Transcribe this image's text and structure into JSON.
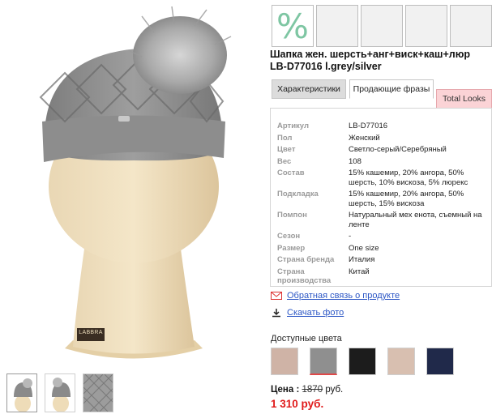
{
  "product": {
    "title_line1": "Шапка жен. шерсть+анг+виск+каш+люр",
    "title_line2": "LB-D77016 l.grey/silver",
    "sale_badge": "%",
    "brand_label": "LABBRA"
  },
  "tabs": [
    {
      "label": "Характеристики"
    },
    {
      "label": "Продающие фразы"
    },
    {
      "label": "Total Looks"
    }
  ],
  "specs": [
    {
      "key": "Артикул",
      "value": "LB-D77016"
    },
    {
      "key": "Пол",
      "value": "Женский"
    },
    {
      "key": "Цвет",
      "value": "Светло-серый/Серебряный"
    },
    {
      "key": "Вес",
      "value": "108"
    },
    {
      "key": "Состав",
      "value": "15% кашемир, 20% ангора, 50% шерсть, 10% вискоза, 5% люрекс"
    },
    {
      "key": "Подкладка",
      "value": "15% кашемир, 20% ангора, 50% шерсть, 15% вискоза"
    },
    {
      "key": "Помпон",
      "value": "Натуральный мех енота, съемный на ленте"
    },
    {
      "key": "Сезон",
      "value": "-"
    },
    {
      "key": "Размер",
      "value": "One size"
    },
    {
      "key": "Страна бренда",
      "value": "Италия"
    },
    {
      "key": "Страна производства",
      "value": "Китай"
    }
  ],
  "links": {
    "feedback": "Обратная связь о продукте",
    "download": "Скачать фото"
  },
  "colors": {
    "label": "Доступные цвета",
    "swatches": [
      "#cfb3a6",
      "#8f8f8f",
      "#1c1c1c",
      "#d8bfb0",
      "#20294a"
    ]
  },
  "price": {
    "label": "Цена :",
    "old": "1870",
    "currency": "руб.",
    "new": "1 310 руб."
  }
}
